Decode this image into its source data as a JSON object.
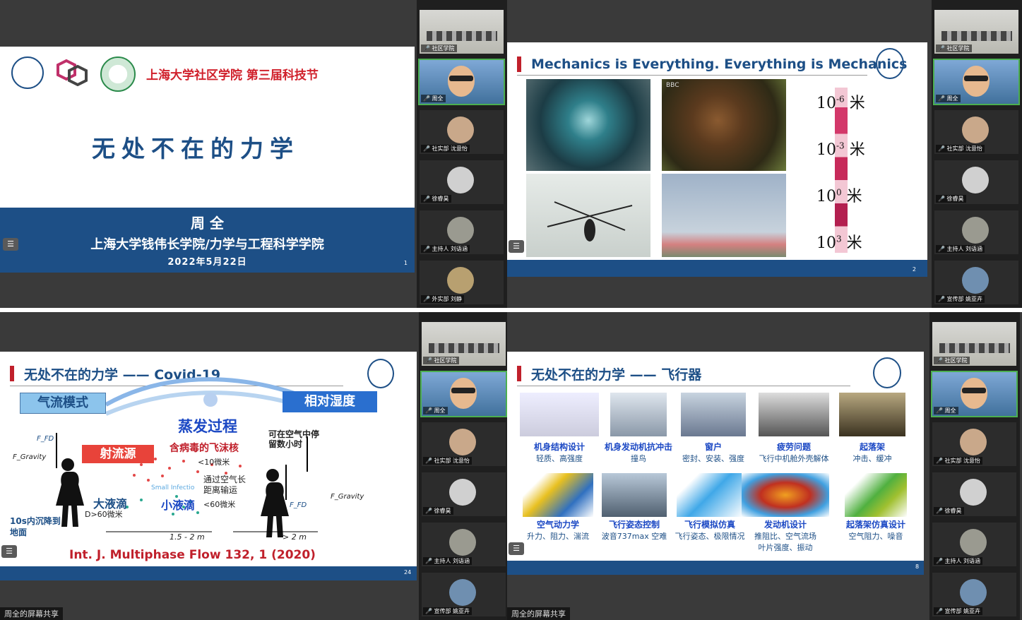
{
  "slide1": {
    "header_title": "上海大学社区学院 第三届科技节",
    "main_title": "无处不在的力学",
    "presenter": "周 全",
    "affiliation": "上海大学钱伟长学院/力学与工程科学学院",
    "date": "2022年5月22日",
    "page_number": "1"
  },
  "slide2": {
    "title": "Mechanics is Everything. Everything is Mechanics",
    "bbc_label": "BBC",
    "scale_labels": [
      "10",
      "10",
      "10",
      "10"
    ],
    "scale_exponents": [
      "-6",
      "-3",
      "0",
      "3"
    ],
    "scale_unit": "米",
    "page_number": "2"
  },
  "slide3": {
    "title": "无处不在的力学 —— Covid-19",
    "airflow_mode": "气流模式",
    "relative_humidity": "相对湿度",
    "evaporation": "蒸发过程",
    "stay_in_air": "可在空气中停留数小时",
    "jet_source": "射流源",
    "virus_droplet": "含病毒的飞沫核",
    "lt10": "<10微米",
    "long_range": "通过空气长距离输运",
    "small_infection": "Small Infectio",
    "large_drop": "大液滴",
    "gt60": "D>60微米",
    "small_drop": "小液滴",
    "lt60": "<60微米",
    "settle": "10s内沉降到地面",
    "dist1": "1.5 - 2 m",
    "dist2": "> 2 m",
    "citation": "Int. J. Multiphase Flow 132, 1 (2020)",
    "f_fd": "F_FD",
    "f_gravity": "F_Gravity",
    "page_number": "24",
    "share_label": "周全的屏幕共享"
  },
  "slide4": {
    "title": "无处不在的力学 —— 飞行器",
    "row1": [
      {
        "t": "机身结构设计",
        "s": "轻质、高强度"
      },
      {
        "t": "机身发动机抗冲击",
        "s": "撞鸟"
      },
      {
        "t": "窗户",
        "s": "密封、安装、强度"
      },
      {
        "t": "疲劳问题",
        "s": "飞行中机舱外壳解体"
      },
      {
        "t": "起落架",
        "s": "冲击、缓冲"
      }
    ],
    "row2": [
      {
        "t": "空气动力学",
        "s": "升力、阻力、湍流"
      },
      {
        "t": "飞行姿态控制",
        "s": "波音737max 空难"
      },
      {
        "t": "飞行模拟仿真",
        "s": "飞行姿态、极限情况"
      },
      {
        "t": "发动机设计",
        "s": "推阻比、空气流场",
        "s2": "叶片强度、振动"
      },
      {
        "t": "起落架仿真设计",
        "s": "空气阻力、噪音"
      }
    ],
    "page_number": "8",
    "share_label": "周全的屏幕共享"
  },
  "participants": [
    {
      "name": "社区学院",
      "kind": "room"
    },
    {
      "name": "周全",
      "kind": "person",
      "active": true
    },
    {
      "name": "社实部 沈意怡",
      "kind": "avatar",
      "color": "#c9a88a"
    },
    {
      "name": "徐睿昊",
      "kind": "avatar",
      "color": "#d0d0d0"
    },
    {
      "name": "主持人 刘语涵",
      "kind": "avatar",
      "color": "#9a9a90"
    },
    {
      "name": "宣传部 姚亚卉",
      "kind": "avatar",
      "color": "#6f8fb0"
    }
  ],
  "participants_q1": [
    {
      "name": "社区学院",
      "kind": "room"
    },
    {
      "name": "周全",
      "kind": "person",
      "active": true
    },
    {
      "name": "社实部 沈意怡",
      "kind": "avatar",
      "color": "#c9a88a"
    },
    {
      "name": "徐睿昊",
      "kind": "avatar",
      "color": "#d0d0d0"
    },
    {
      "name": "主持人 刘语涵",
      "kind": "avatar",
      "color": "#9a9a90"
    },
    {
      "name": "外实部 刘静",
      "kind": "avatar",
      "color": "#b8a070"
    }
  ],
  "icons": {
    "menu": "menu-icon",
    "mic": "mic-icon",
    "user": "user-icon"
  }
}
